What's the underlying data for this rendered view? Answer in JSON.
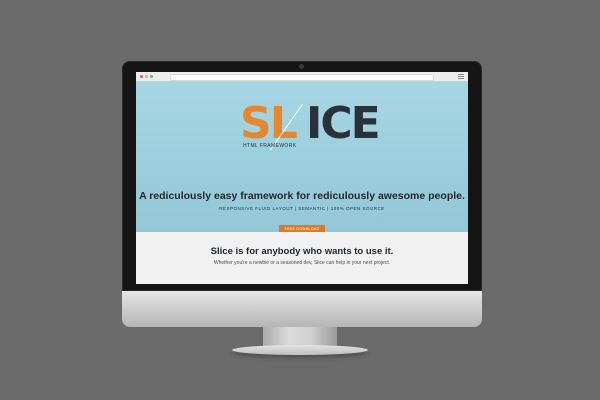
{
  "logo": {
    "left_text": "SL",
    "right_text": "ICE",
    "subtitle": "HTML FRAMEWORK",
    "brand_color": "#e6862f",
    "dark_color": "#2b3138"
  },
  "hero": {
    "tagline": "A rediculously easy framework for rediculously awesome people.",
    "features": "RESPONSIVE FLUID LAYOUT | SEMANTIC | 100% OPEN SOURCE",
    "download_label": "FREE DOWNLOAD",
    "background_color": "#9bcfdd"
  },
  "content": {
    "heading": "Slice is for anybody who wants to use it.",
    "subtext": "Whether you're a newbie or a seasoned dev, Slice can help in your next project."
  },
  "icons": [
    "close-dot-icon",
    "minimize-dot-icon",
    "maximize-dot-icon",
    "menu-icon",
    "camera-icon"
  ]
}
